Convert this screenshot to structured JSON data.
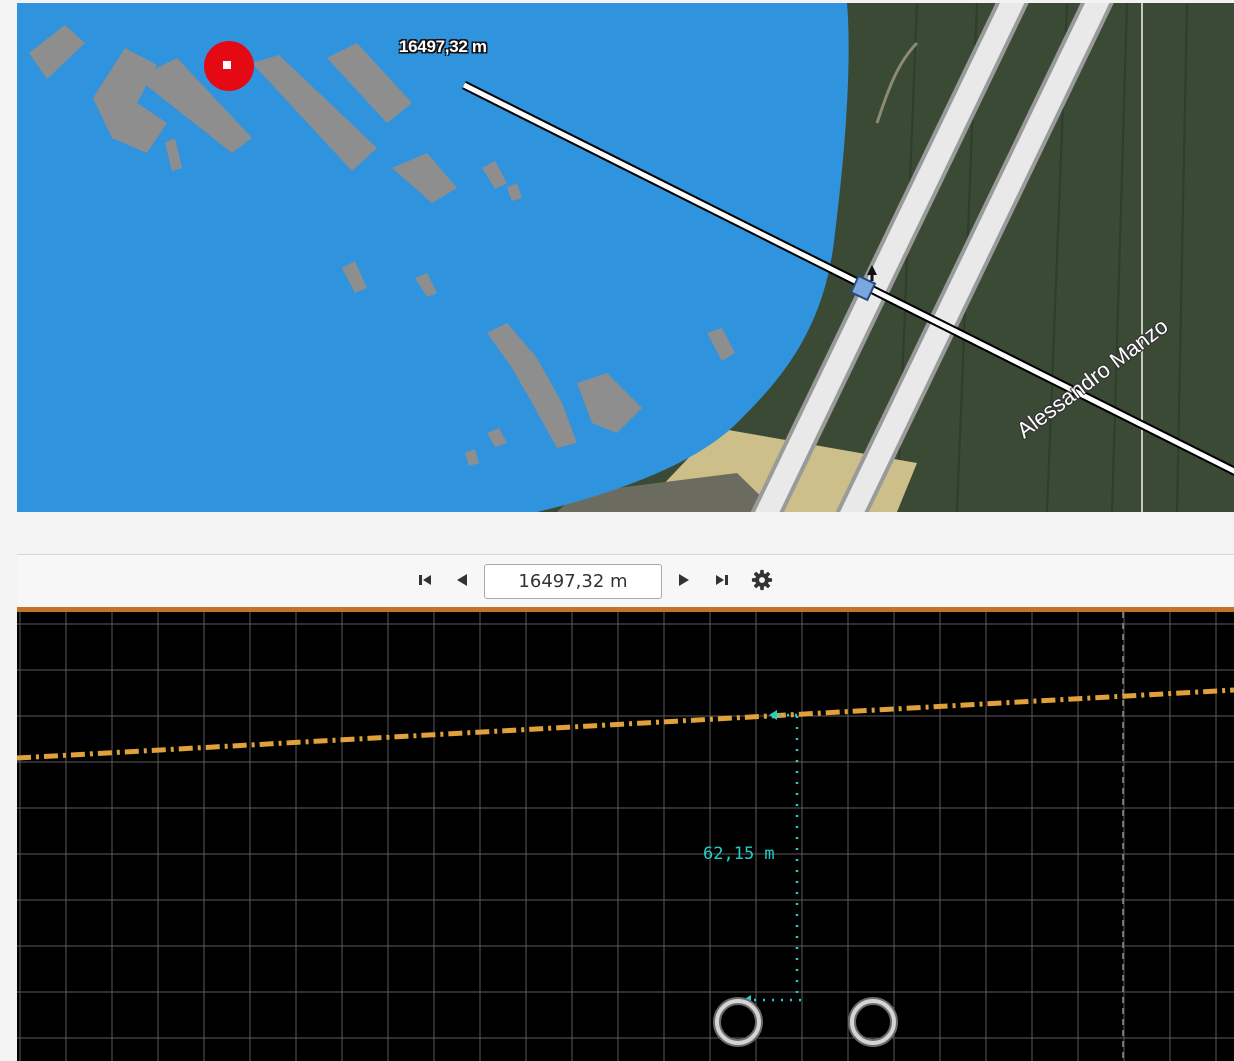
{
  "map": {
    "measurement_label": "16497,32 m",
    "street_label": "Alessandro Manzo",
    "colors": {
      "water": "#2f93dd",
      "building": "#8e8e8e",
      "marker": "#e50914",
      "terrain": "#3a4a35"
    }
  },
  "toolbar": {
    "first_icon": "skip-to-start-icon",
    "prev_icon": "step-back-icon",
    "position_value": "16497,32 m",
    "next_icon": "step-forward-icon",
    "last_icon": "skip-to-end-icon",
    "settings_icon": "gear-icon"
  },
  "profile": {
    "depth_label": "62,15 m",
    "colors": {
      "background": "#000000",
      "grid": "#5a5a5a",
      "terrain_line": "#e0a13a",
      "measure": "#20d0c8",
      "pipe": "#bfbfbf"
    }
  }
}
